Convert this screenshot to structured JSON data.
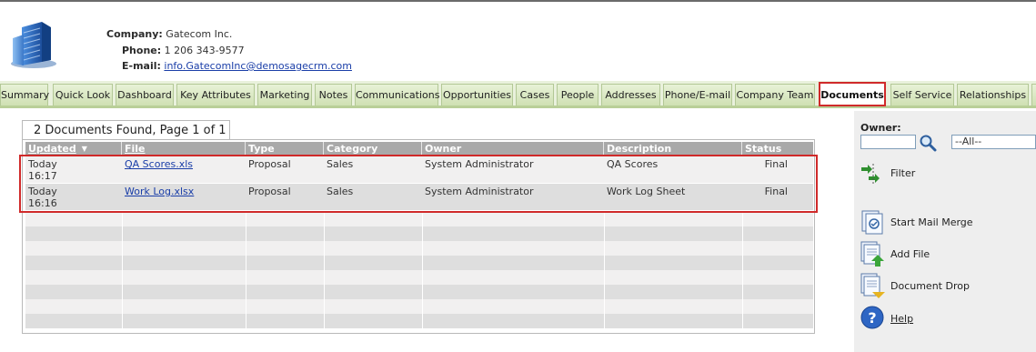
{
  "company": {
    "company_label": "Company:",
    "company_value": "Gatecom Inc.",
    "phone_label": "Phone:",
    "phone_value": "1 206 343-9577",
    "email_label": "E-mail:",
    "email_value": "info.GatecomInc@demosagecrm.com"
  },
  "tabs": [
    {
      "label": "Summary"
    },
    {
      "label": "Quick Look"
    },
    {
      "label": "Dashboard"
    },
    {
      "label": "Key Attributes"
    },
    {
      "label": "Marketing"
    },
    {
      "label": "Notes"
    },
    {
      "label": "Communications"
    },
    {
      "label": "Opportunities"
    },
    {
      "label": "Cases"
    },
    {
      "label": "People"
    },
    {
      "label": "Addresses"
    },
    {
      "label": "Phone/E-mail"
    },
    {
      "label": "Company Team"
    },
    {
      "label": "Documents",
      "active": true
    },
    {
      "label": "Self Service"
    },
    {
      "label": "Relationships"
    }
  ],
  "results": {
    "title": "2 Documents Found, Page 1 of 1"
  },
  "grid": {
    "columns": [
      "Updated",
      "File",
      "Type",
      "Category",
      "Owner",
      "Description",
      "Status"
    ],
    "sort_indicator": "▼",
    "rows": [
      {
        "updated_day": "Today",
        "updated_time": "16:17",
        "file": "QA Scores.xls",
        "type": "Proposal",
        "category": "Sales",
        "owner": "System Administrator",
        "description": "QA Scores",
        "status": "Final"
      },
      {
        "updated_day": "Today",
        "updated_time": "16:16",
        "file": "Work Log.xlsx",
        "type": "Proposal",
        "category": "Sales",
        "owner": "System Administrator",
        "description": "Work Log Sheet",
        "status": "Final"
      }
    ]
  },
  "sidebar": {
    "owner_label": "Owner:",
    "owner_select_value": "--All--",
    "filter_label": "Filter",
    "actions": [
      {
        "label": "Start Mail Merge",
        "icon": "mail-merge-icon"
      },
      {
        "label": "Add File",
        "icon": "add-file-icon"
      },
      {
        "label": "Document Drop",
        "icon": "document-drop-icon"
      },
      {
        "label": "Help",
        "icon": "help-icon"
      }
    ]
  },
  "colors": {
    "tab_bar": "#e9f1dc",
    "highlight": "#d02a2a",
    "grid_header": "#a9a9a9",
    "link": "#1a3ea8"
  }
}
